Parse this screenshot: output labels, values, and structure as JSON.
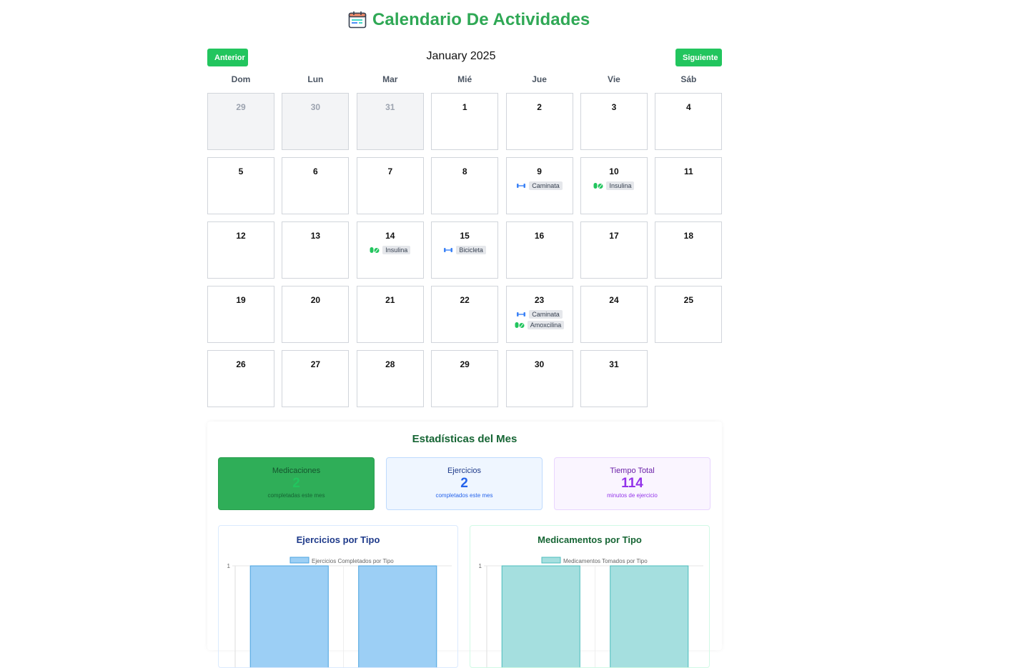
{
  "header": {
    "title": "Calendario De Actividades",
    "icon": "calendar-icon"
  },
  "nav": {
    "prev_label": "Anterior",
    "next_label": "Siguiente",
    "month_label": "January 2025"
  },
  "weekdays": [
    "Dom",
    "Lun",
    "Mar",
    "Mié",
    "Jue",
    "Vie",
    "Sáb"
  ],
  "days": [
    {
      "day": "29",
      "other": true
    },
    {
      "day": "30",
      "other": true
    },
    {
      "day": "31",
      "other": true
    },
    {
      "day": "1"
    },
    {
      "day": "2"
    },
    {
      "day": "3"
    },
    {
      "day": "4"
    },
    {
      "day": "5"
    },
    {
      "day": "6"
    },
    {
      "day": "7"
    },
    {
      "day": "8"
    },
    {
      "day": "9",
      "events": [
        {
          "type": "exercise",
          "label": "Caminata"
        }
      ]
    },
    {
      "day": "10",
      "events": [
        {
          "type": "medication",
          "label": "Insulina"
        }
      ]
    },
    {
      "day": "11"
    },
    {
      "day": "12"
    },
    {
      "day": "13"
    },
    {
      "day": "14",
      "events": [
        {
          "type": "medication",
          "label": "Insulina"
        }
      ]
    },
    {
      "day": "15",
      "events": [
        {
          "type": "exercise",
          "label": "Bicicleta"
        }
      ]
    },
    {
      "day": "16"
    },
    {
      "day": "17"
    },
    {
      "day": "18"
    },
    {
      "day": "19"
    },
    {
      "day": "20"
    },
    {
      "day": "21"
    },
    {
      "day": "22"
    },
    {
      "day": "23",
      "events": [
        {
          "type": "exercise",
          "label": "Caminata"
        },
        {
          "type": "medication",
          "label": "Amoxcilina"
        }
      ]
    },
    {
      "day": "24"
    },
    {
      "day": "25"
    },
    {
      "day": "26"
    },
    {
      "day": "27"
    },
    {
      "day": "28"
    },
    {
      "day": "29"
    },
    {
      "day": "30"
    },
    {
      "day": "31"
    }
  ],
  "stats": {
    "title": "Estadísticas del Mes",
    "medications": {
      "title": "Medicaciones",
      "value": "2",
      "sub": "completadas este mes"
    },
    "exercises": {
      "title": "Ejercicios",
      "value": "2",
      "sub": "completados este mes"
    },
    "time": {
      "title": "Tiempo Total",
      "value": "114",
      "sub": "minutos de ejercicio"
    }
  },
  "chart_data": [
    {
      "type": "bar",
      "title": "Ejercicios por Tipo",
      "series": [
        {
          "name": "Ejercicios Completados por Tipo",
          "values": [
            1,
            1
          ]
        }
      ],
      "y_tick_labels": [
        "1"
      ],
      "color": "#9ccff5",
      "border_color": "#4aa3e0"
    },
    {
      "type": "bar",
      "title": "Medicamentos por Tipo",
      "series": [
        {
          "name": "Medicamentos Tomados por Tipo",
          "values": [
            1,
            1
          ]
        }
      ],
      "y_tick_labels": [
        "1"
      ],
      "color": "#a5dfdf",
      "border_color": "#4bbcbc"
    }
  ],
  "colors": {
    "accent": "#22c55e",
    "title": "#2fa855",
    "exercise_icon": "#3b82f6",
    "medication_icon": "#22c55e"
  }
}
